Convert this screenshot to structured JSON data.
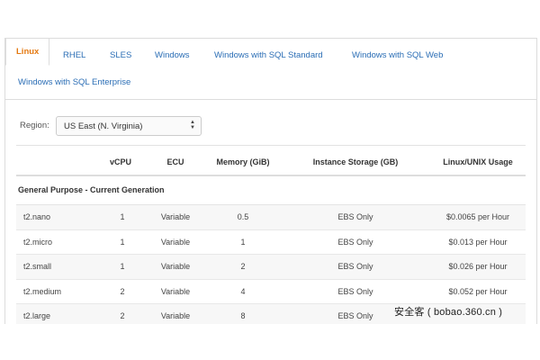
{
  "tabs": [
    {
      "label": "Linux",
      "active": true
    },
    {
      "label": "RHEL"
    },
    {
      "label": "SLES"
    },
    {
      "label": "Windows"
    },
    {
      "label": "Windows with SQL Standard"
    },
    {
      "label": "Windows with SQL Web"
    },
    {
      "label": "Windows with SQL Enterprise"
    }
  ],
  "region": {
    "label": "Region:",
    "selected": "US East (N. Virginia)",
    "icon": "chevron-updown-icon"
  },
  "table": {
    "headers": {
      "name": "",
      "vcpu": "vCPU",
      "ecu": "ECU",
      "memory": "Memory (GiB)",
      "storage": "Instance Storage (GB)",
      "usage": "Linux/UNIX Usage"
    },
    "section": "General Purpose - Current Generation",
    "rows": [
      {
        "name": "t2.nano",
        "vcpu": "1",
        "ecu": "Variable",
        "memory": "0.5",
        "storage": "EBS Only",
        "usage": "$0.0065 per Hour"
      },
      {
        "name": "t2.micro",
        "vcpu": "1",
        "ecu": "Variable",
        "memory": "1",
        "storage": "EBS Only",
        "usage": "$0.013 per Hour"
      },
      {
        "name": "t2.small",
        "vcpu": "1",
        "ecu": "Variable",
        "memory": "2",
        "storage": "EBS Only",
        "usage": "$0.026 per Hour"
      },
      {
        "name": "t2.medium",
        "vcpu": "2",
        "ecu": "Variable",
        "memory": "4",
        "storage": "EBS Only",
        "usage": "$0.052 per Hour"
      },
      {
        "name": "t2.large",
        "vcpu": "2",
        "ecu": "Variable",
        "memory": "8",
        "storage": "EBS Only",
        "usage": ""
      }
    ]
  },
  "watermark": "安全客 ( bobao.360.cn )",
  "colors": {
    "link": "#2a6db5",
    "active_tab": "#e47911",
    "stripe": "#f7f7f7",
    "border": "#dddddd"
  }
}
